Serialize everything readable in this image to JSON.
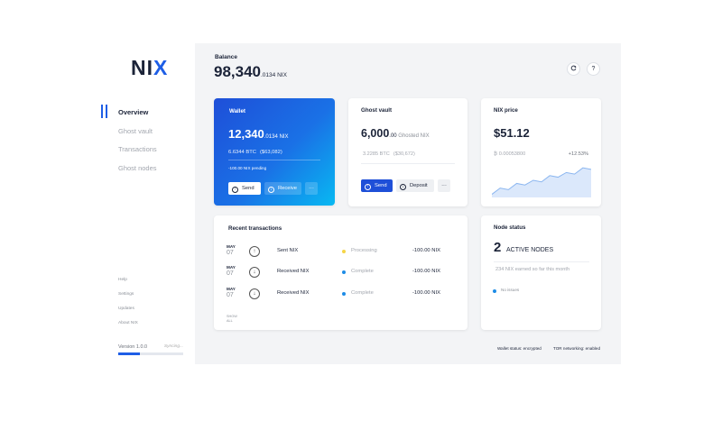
{
  "app": {
    "logo_prefix": "NI",
    "logo_accent": "X"
  },
  "sidebar": {
    "items": [
      {
        "label": "Overview"
      },
      {
        "label": "Ghost vault"
      },
      {
        "label": "Transactions"
      },
      {
        "label": "Ghost nodes"
      }
    ],
    "footer_links": [
      {
        "label": "Help"
      },
      {
        "label": "Settings"
      },
      {
        "label": "Updates"
      },
      {
        "label": "About NIX"
      }
    ],
    "version": "Version 1.0.0",
    "sync_status": "Syncing...",
    "sync_progress": 0.33
  },
  "header": {
    "balance_label": "Balance",
    "balance_int": "98,340",
    "balance_dec": ".0134 NIX",
    "refresh_icon": "refresh-icon",
    "help_label": "?"
  },
  "wallet": {
    "title": "Wallet",
    "amount_int": "12,340",
    "amount_dec": ".0134 NIX",
    "btc": "6.6344 BTC",
    "usd": "($63,082)",
    "pending": "-100.00 NIX pending",
    "send_label": "Send",
    "receive_label": "Receive",
    "more_label": "···"
  },
  "ghost_vault": {
    "title": "Ghost vault",
    "amount_int": "6,000",
    "amount_dec": ".00",
    "amount_suffix": " Ghosted NIX",
    "btc": "3.2285 BTC",
    "usd": "($30,672)",
    "send_label": "Send",
    "deposit_label": "Deposit",
    "more_label": "···"
  },
  "nix_price": {
    "title": "NIX price",
    "price": "$51.12",
    "btc_price": "₿ 0.00053800",
    "change": "+12.53%"
  },
  "recent_transactions": {
    "title": "Recent transactions",
    "rows": [
      {
        "month": "MAY",
        "day": "07",
        "direction": "up",
        "name": "Sent NIX",
        "status": "Processing",
        "status_color": "#f5d547",
        "amount": "-100.00 NIX"
      },
      {
        "month": "MAY",
        "day": "07",
        "direction": "down",
        "name": "Received NIX",
        "status": "Complete",
        "status_color": "#1e8ce6",
        "amount": "-100.00 NIX"
      },
      {
        "month": "MAY",
        "day": "07",
        "direction": "down",
        "name": "Received NIX",
        "status": "Complete",
        "status_color": "#1e8ce6",
        "amount": "-100.00 NIX"
      }
    ],
    "show_all": "SHOW ALL"
  },
  "node_status": {
    "title": "Node status",
    "count": "2",
    "count_label": "ACTIVE NODES",
    "earned": "234 NIX earned so far this month",
    "issues": "No issues"
  },
  "statusbar": {
    "wallet_status": "Wallet status: encrypted",
    "tor_status": "TOR networking: enabled"
  },
  "chart_data": {
    "type": "area",
    "x": [
      0,
      1,
      2,
      3,
      4,
      5,
      6,
      7,
      8,
      9,
      10,
      11,
      12
    ],
    "values": [
      2,
      6,
      5,
      9,
      8,
      11,
      10,
      14,
      13,
      16,
      15,
      19,
      18
    ],
    "ylim": [
      0,
      22
    ],
    "grid": false,
    "color": "#8bb6f0"
  }
}
